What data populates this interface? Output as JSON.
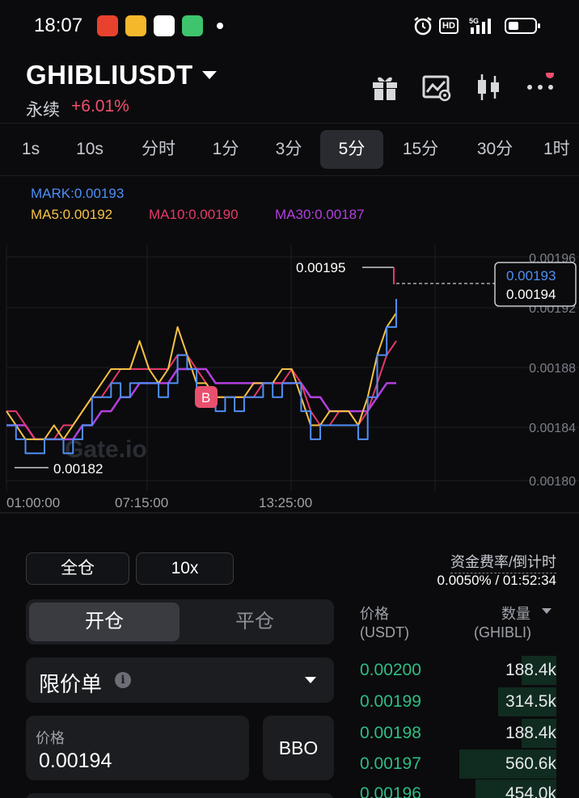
{
  "status_bar": {
    "time": "18:07",
    "icons": [
      "hd-icon",
      "signal-5g-icon",
      "battery-icon",
      "alarm-icon"
    ],
    "network": "5G",
    "hd": "HD"
  },
  "header": {
    "symbol": "GHIBLIUSDT",
    "contract_type": "永续",
    "change": "+6.01%",
    "change_color": "#f0506e",
    "icons": [
      "gift-icon",
      "chart-settings-icon",
      "candlestick-icon",
      "more-icon"
    ]
  },
  "intervals": {
    "items": [
      "1s",
      "10s",
      "分时",
      "1分",
      "3分",
      "5分",
      "15分",
      "30分",
      "1时"
    ],
    "active": "5分"
  },
  "indicators": {
    "mark": "MARK:0.00193",
    "ma5": "MA5:0.00192",
    "ma10": "MA10:0.00190",
    "ma30": "MA30:0.00187",
    "colors": {
      "mark": "#4f8ff7",
      "ma5": "#f7c244",
      "ma10": "#e8386b",
      "ma30": "#b33fe0"
    }
  },
  "chart_data": {
    "type": "line",
    "y_axis_labels": [
      "0.00196",
      "0.00192",
      "0.00188",
      "0.00184",
      "0.00180"
    ],
    "ylim": [
      0.0018,
      0.00196
    ],
    "x_axis_labels": [
      "01:00:00",
      "07:15:00",
      "13:25:00"
    ],
    "high_label": "0.00195",
    "low_label": "0.00182",
    "last_mark_price": "0.00193",
    "last_price": "0.00194",
    "trade_marker": "B",
    "watermark": "Gate.io",
    "series": [
      {
        "name": "MARK",
        "color": "#4f8ff7",
        "values": [
          0.00184,
          0.00183,
          0.00182,
          0.00182,
          0.00183,
          0.00183,
          0.00182,
          0.00183,
          0.00184,
          0.00186,
          0.00186,
          0.00187,
          0.00186,
          0.00187,
          0.00187,
          0.00187,
          0.00186,
          0.00187,
          0.00189,
          0.00188,
          0.00186,
          0.00186,
          0.00185,
          0.00186,
          0.00185,
          0.00186,
          0.00186,
          0.00187,
          0.00186,
          0.00187,
          0.00187,
          0.00185,
          0.00183,
          0.00184,
          0.00184,
          0.00184,
          0.00184,
          0.00183,
          0.00186,
          0.00189,
          0.00191,
          0.00193
        ]
      },
      {
        "name": "MA5",
        "color": "#f7c244",
        "values": [
          0.00185,
          0.00184,
          0.00183,
          0.00183,
          0.00183,
          0.00184,
          0.00183,
          0.00184,
          0.00185,
          0.00186,
          0.00187,
          0.00188,
          0.00188,
          0.00188,
          0.0019,
          0.00188,
          0.00187,
          0.00188,
          0.00191,
          0.00189,
          0.00187,
          0.00187,
          0.00186,
          0.00186,
          0.00186,
          0.00186,
          0.00187,
          0.00187,
          0.00187,
          0.00188,
          0.00188,
          0.00186,
          0.00184,
          0.00184,
          0.00185,
          0.00185,
          0.00185,
          0.00184,
          0.00186,
          0.00189,
          0.00191,
          0.00192
        ]
      },
      {
        "name": "MA10",
        "color": "#e8386b",
        "values": [
          0.00185,
          0.00185,
          0.00184,
          0.00183,
          0.00183,
          0.00183,
          0.00184,
          0.00184,
          0.00185,
          0.00186,
          0.00186,
          0.00187,
          0.00188,
          0.00188,
          0.00188,
          0.00188,
          0.00188,
          0.00188,
          0.00189,
          0.00189,
          0.00188,
          0.00187,
          0.00186,
          0.00186,
          0.00186,
          0.00186,
          0.00186,
          0.00187,
          0.00187,
          0.00187,
          0.00188,
          0.00187,
          0.00185,
          0.00184,
          0.00184,
          0.00185,
          0.00185,
          0.00184,
          0.00185,
          0.00187,
          0.00189,
          0.0019
        ]
      },
      {
        "name": "MA30",
        "color": "#b33fe0",
        "values": [
          0.00184,
          0.00184,
          0.00184,
          0.00183,
          0.00183,
          0.00183,
          0.00183,
          0.00183,
          0.00184,
          0.00184,
          0.00185,
          0.00185,
          0.00186,
          0.00186,
          0.00187,
          0.00187,
          0.00187,
          0.00187,
          0.00188,
          0.00188,
          0.00188,
          0.00188,
          0.00187,
          0.00187,
          0.00187,
          0.00187,
          0.00187,
          0.00187,
          0.00187,
          0.00187,
          0.00187,
          0.00187,
          0.00186,
          0.00186,
          0.00185,
          0.00185,
          0.00185,
          0.00185,
          0.00185,
          0.00186,
          0.00187,
          0.00187
        ]
      }
    ]
  },
  "form": {
    "margin_mode": "全仓",
    "leverage": "10x",
    "funding_label": "资金费率/倒计时",
    "funding_value": "0.0050% / 01:52:34",
    "open_tab": "开仓",
    "close_tab": "平仓",
    "order_type": "限价单",
    "price_label": "价格",
    "price_value": "0.00194",
    "bbo": "BBO"
  },
  "orderbook": {
    "price_header": "价格",
    "price_unit": "(USDT)",
    "qty_header": "数量",
    "qty_unit": "(GHIBLI)",
    "price_color": "#2ebd85",
    "rows": [
      {
        "price": "0.00200",
        "qty": "188.4k",
        "depth": 0.15
      },
      {
        "price": "0.00199",
        "qty": "314.5k",
        "depth": 0.25
      },
      {
        "price": "0.00198",
        "qty": "188.4k",
        "depth": 0.15
      },
      {
        "price": "0.00197",
        "qty": "560.6k",
        "depth": 0.42
      },
      {
        "price": "0.00196",
        "qty": "454.0k",
        "depth": 0.35
      }
    ]
  }
}
